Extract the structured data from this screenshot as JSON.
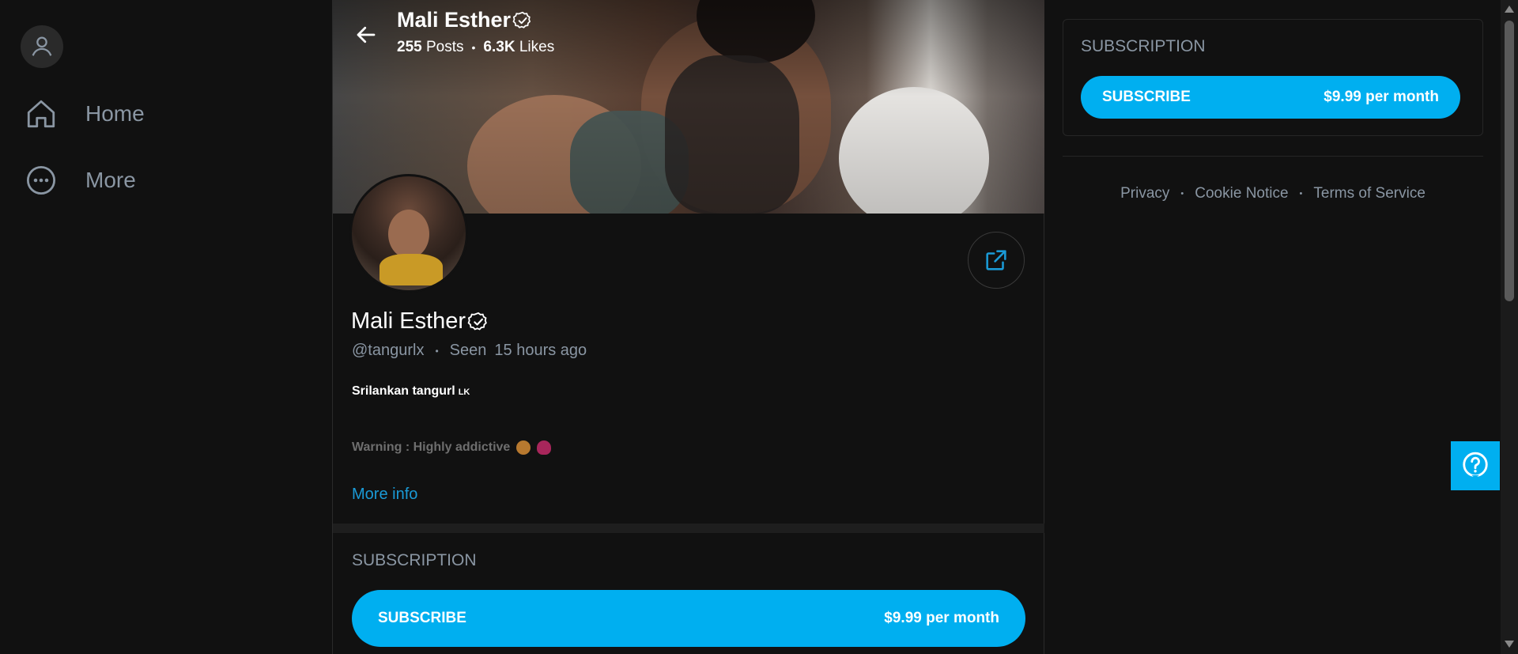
{
  "sidebar": {
    "items": [
      {
        "label": "Home",
        "icon": "home-icon"
      },
      {
        "label": "More",
        "icon": "more-icon"
      }
    ]
  },
  "header": {
    "name": "Mali Esther",
    "posts_count": "255",
    "posts_label": "Posts",
    "likes_count": "6.3K",
    "likes_label": "Likes"
  },
  "profile": {
    "name": "Mali Esther",
    "handle": "@tangurlx",
    "seen_label": "Seen",
    "seen_time": "15 hours ago",
    "bio_line1": "Srilankan tangurl",
    "bio_flag": "LK",
    "bio_line2": "Warning : Highly addictive",
    "more_info": "More info"
  },
  "subscription_main": {
    "title": "SUBSCRIPTION",
    "button_label": "SUBSCRIBE",
    "price": "$9.99 per month"
  },
  "subscription_side": {
    "title": "SUBSCRIPTION",
    "button_label": "SUBSCRIBE",
    "price": "$9.99 per month"
  },
  "footer": {
    "privacy": "Privacy",
    "cookie": "Cookie Notice",
    "terms": "Terms of Service"
  },
  "colors": {
    "accent": "#00aff0",
    "link": "#1a9ad6",
    "muted": "#8a96a3",
    "background": "#111111"
  }
}
